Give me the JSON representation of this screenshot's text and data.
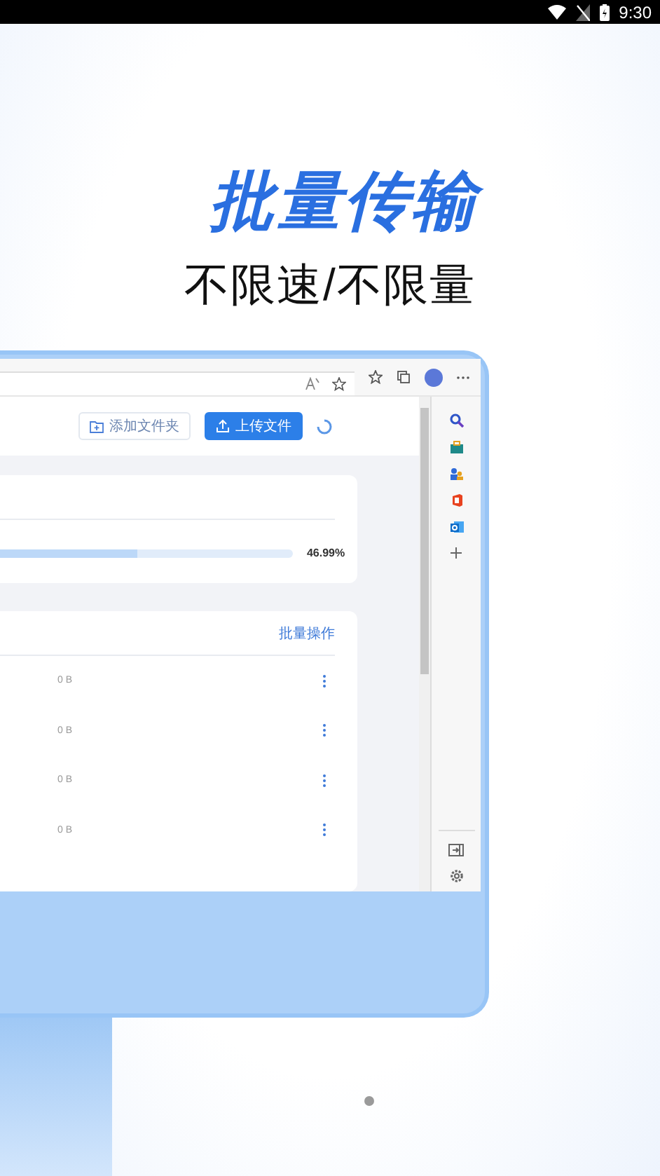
{
  "status_bar": {
    "time": "9:30"
  },
  "headline": "批量传输",
  "subheadline": "不限速/不限量",
  "page": {
    "buttons": [
      {
        "label": "添加文件夹",
        "kind": "secondary"
      },
      {
        "label": "上传文件",
        "kind": "primary"
      }
    ],
    "progress": {
      "level": 0.4699,
      "reading": "46.99%"
    },
    "list": {
      "action": "批量操作",
      "rows": [
        {
          "size": "0 B"
        },
        {
          "size": "0 B"
        },
        {
          "size": "0 B"
        },
        {
          "size": "0 B"
        }
      ]
    }
  },
  "page_indicator": [
    {
      "selected": true
    }
  ]
}
